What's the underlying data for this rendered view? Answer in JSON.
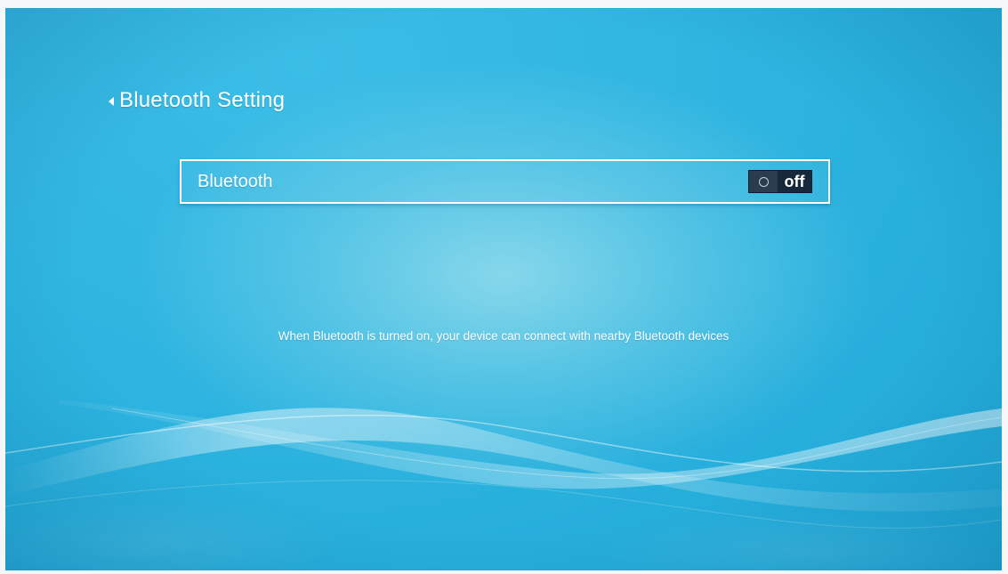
{
  "header": {
    "title": "Bluetooth Setting"
  },
  "settings": {
    "bluetooth": {
      "label": "Bluetooth",
      "state": "off"
    }
  },
  "info": {
    "text": "When Bluetooth is turned on, your device can connect with nearby Bluetooth devices"
  },
  "colors": {
    "background": "#2cb3df",
    "toggle_background": "#16283a",
    "text": "#ffffff"
  },
  "icons": {
    "back": "back-arrow-icon",
    "toggle_knob": "toggle-knob-icon"
  }
}
